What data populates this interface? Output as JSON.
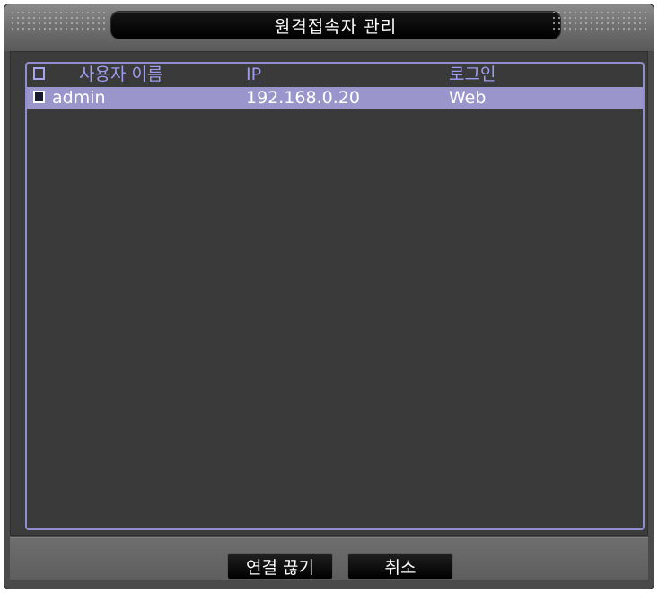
{
  "window": {
    "title": "원격접속자 관리"
  },
  "table": {
    "headers": {
      "name": "사용자 이름",
      "ip": "IP",
      "login": "로그인"
    },
    "rows": [
      {
        "name": "admin",
        "ip": "192.168.0.20",
        "login": "Web",
        "selected": true
      }
    ]
  },
  "buttons": {
    "disconnect": "연결 끊기",
    "cancel": "취소"
  },
  "colors": {
    "accent": "#9a96cc",
    "header_text": "#9d9df0",
    "panel": "#3a3a3a"
  }
}
